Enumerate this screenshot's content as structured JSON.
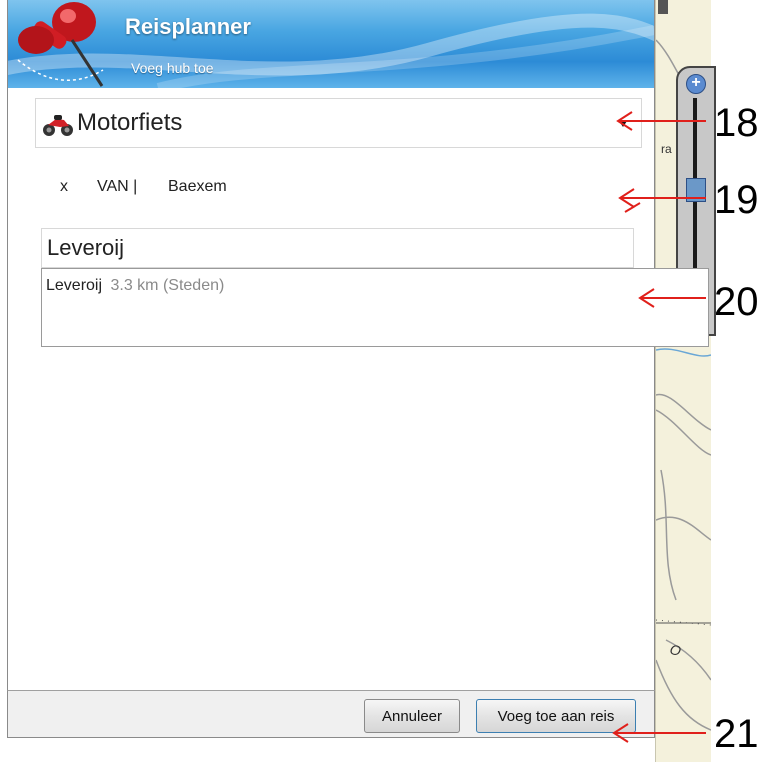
{
  "dialog": {
    "title": "Reisplanner",
    "subtitle": "Voeg hub toe",
    "vehicle": {
      "label": "Motorfiets",
      "icon": "motorcycle-icon"
    },
    "route": {
      "remove": "x",
      "from_label": "VAN |",
      "place": "Baexem"
    },
    "search": {
      "value": "Leveroij"
    },
    "suggestion": {
      "name": "Leveroij",
      "detail": "3.3 km (Steden)"
    },
    "buttons": {
      "cancel": "Annuleer",
      "add": "Voeg toe aan reis"
    }
  },
  "map": {
    "label_fragment": "O",
    "road_label": "ra"
  },
  "annotations": [
    {
      "number": "18"
    },
    {
      "number": "19"
    },
    {
      "number": "20"
    },
    {
      "number": "21"
    }
  ],
  "colors": {
    "title_bar": "#2c8bd6",
    "annotation_arrow": "#e0201b",
    "map_background": "#f4f1dc"
  }
}
